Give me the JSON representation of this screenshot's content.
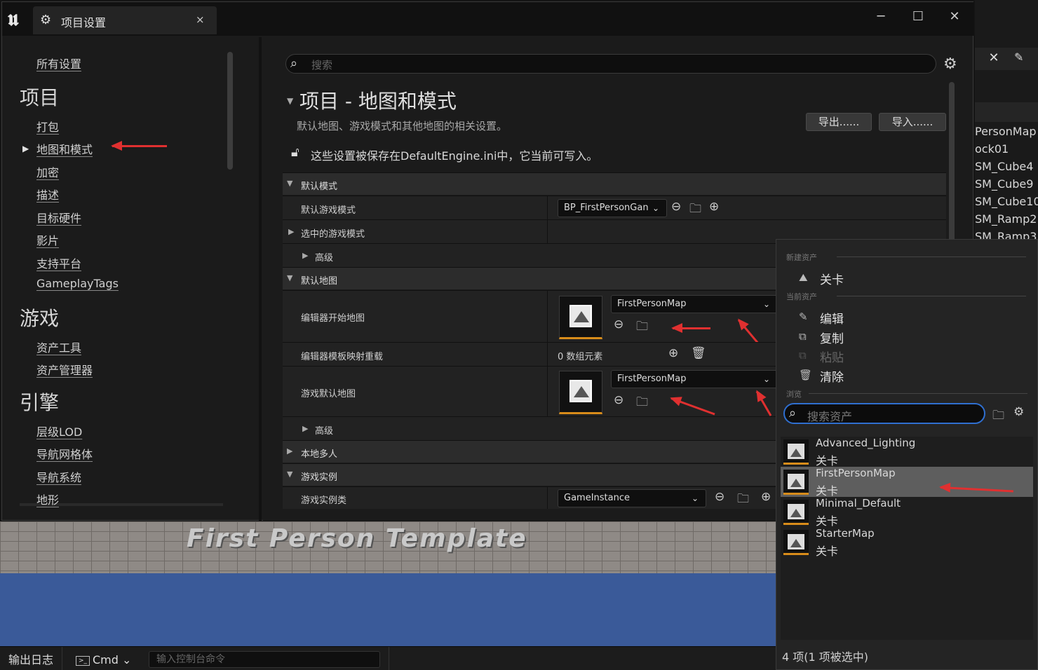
{
  "window": {
    "tab_label": "项目设置",
    "tab_close": "×",
    "minimize": "─",
    "maximize": "☐",
    "close": "✕"
  },
  "nav": {
    "all_settings": "所有设置",
    "groups": [
      {
        "title": "项目",
        "items": [
          "打包",
          "地图和模式",
          "加密",
          "描述",
          "目标硬件",
          "影片",
          "支持平台",
          "GameplayTags"
        ]
      },
      {
        "title": "游戏",
        "items": [
          "资产工具",
          "资产管理器"
        ]
      },
      {
        "title": "引擎",
        "items": [
          "层级LOD",
          "导航网格体",
          "导航系统",
          "地形"
        ]
      }
    ],
    "selected": "地图和模式"
  },
  "settings": {
    "search_placeholder": "搜索",
    "section_title": "项目 - 地图和模式",
    "section_desc": "默认地图、游戏模式和其他地图的相关设置。",
    "export_label": "导出......",
    "import_label": "导入......",
    "save_notice": "这些设置被保存在DefaultEngine.ini中，它当前可写入。",
    "cat_default_modes": "默认模式",
    "default_game_mode_label": "默认游戏模式",
    "default_game_mode_value": "BP_FirstPersonGan",
    "selected_game_mode_label": "选中的游戏模式",
    "advanced_label": "高级",
    "cat_default_maps": "默认地图",
    "editor_startup_map_label": "编辑器开始地图",
    "editor_startup_map_value": "FirstPersonMap",
    "editor_template_label": "编辑器模板映射重载",
    "editor_template_value": "0 数组元素",
    "game_default_map_label": "游戏默认地图",
    "game_default_map_value": "FirstPersonMap",
    "advanced2_label": "高级",
    "cat_local_multiplayer": "本地多人",
    "cat_game_instance": "游戏实例",
    "game_instance_class_label": "游戏实例类",
    "game_instance_class_value": "GameInstance"
  },
  "picker": {
    "sec_new": "新建资产",
    "new_level": "关卡",
    "sec_current": "当前资产",
    "edit": "编辑",
    "copy": "复制",
    "paste": "粘贴",
    "clear": "清除",
    "sec_browse": "浏览",
    "search_placeholder": "搜索资产",
    "assets": [
      {
        "name": "Advanced_Lighting",
        "kind": "关卡"
      },
      {
        "name": "FirstPersonMap",
        "kind": "关卡"
      },
      {
        "name": "Minimal_Default",
        "kind": "关卡"
      },
      {
        "name": "StarterMap",
        "kind": "关卡"
      }
    ],
    "selected_asset": "FirstPersonMap",
    "count_text": "4 项(1 项被选中)"
  },
  "outliner": {
    "items": [
      "PersonMap",
      "ock01",
      "SM_Cube4",
      "SM_Cube9",
      "SM_Cube10",
      "SM_Ramp2",
      "SM_Ramp3"
    ]
  },
  "viewport": {
    "banner": "First Person Template"
  },
  "statusbar": {
    "output_log": "输出日志",
    "cmd": "Cmd",
    "console_placeholder": "输入控制台命令"
  },
  "colors": {
    "accent_search_border": "#2f6fd0",
    "asset_underline": "#d88c1a",
    "annotation_arrow": "#e03030"
  }
}
